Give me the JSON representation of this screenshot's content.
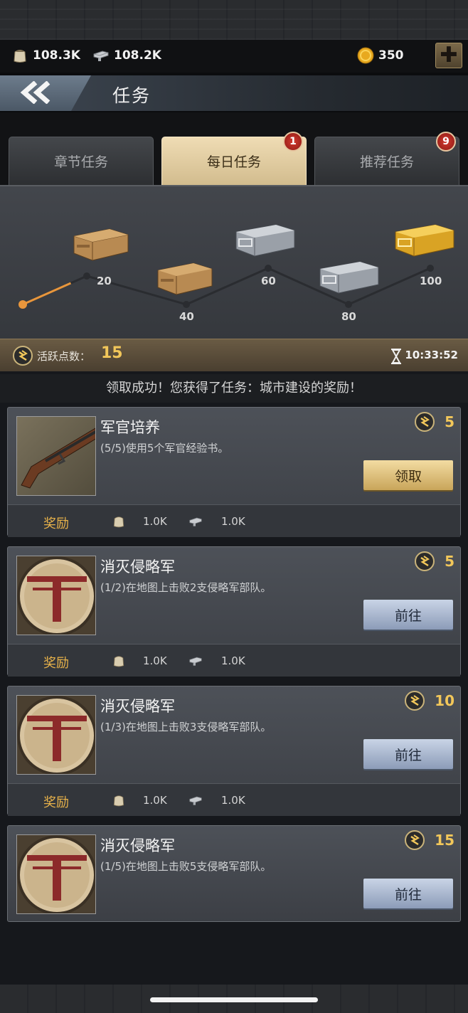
{
  "resources": {
    "food": {
      "icon": "supply-sack-icon",
      "value": "108.3K"
    },
    "steel": {
      "icon": "steel-ingot-icon",
      "value": "108.2K"
    },
    "gold": {
      "icon": "gold-coin-icon",
      "value": "350"
    },
    "add_icon": "plus-icon"
  },
  "header": {
    "title": "任务",
    "back_icon": "double-chevron-left-icon"
  },
  "tabs": [
    {
      "label": "章节任务",
      "active": false,
      "badge": ""
    },
    {
      "label": "每日任务",
      "active": true,
      "badge": "1"
    },
    {
      "label": "推荐任务",
      "active": false,
      "badge": "9"
    }
  ],
  "milestones": [
    {
      "points": "20",
      "chest": "wooden-chest-icon"
    },
    {
      "points": "40",
      "chest": "wooden-chest-icon"
    },
    {
      "points": "60",
      "chest": "steel-chest-icon"
    },
    {
      "points": "80",
      "chest": "steel-chest-icon"
    },
    {
      "points": "100",
      "chest": "gold-chest-icon"
    }
  ],
  "activity": {
    "label": "活跃点数：",
    "value": "15",
    "timer": "10:33:52",
    "progress_fraction": 0.15
  },
  "toast": "领取成功！您获得了任务：城市建设的奖励！",
  "tasks": [
    {
      "title": "军官培养",
      "desc": "(5/5)使用5个军官经验书。",
      "points": "5",
      "action": "领取",
      "action_type": "claim",
      "thumb": "rifle-image",
      "reward_label": "奖励",
      "rewards": [
        {
          "icon": "supply-sack-icon",
          "value": "1.0K"
        },
        {
          "icon": "steel-ingot-icon",
          "value": "1.0K"
        }
      ]
    },
    {
      "title": "消灭侵略军",
      "desc": "(1/2)在地图上击败2支侵略军部队。",
      "points": "5",
      "action": "前往",
      "action_type": "go",
      "thumb": "invader-emblem-image",
      "reward_label": "奖励",
      "rewards": [
        {
          "icon": "supply-sack-icon",
          "value": "1.0K"
        },
        {
          "icon": "steel-ingot-icon",
          "value": "1.0K"
        }
      ]
    },
    {
      "title": "消灭侵略军",
      "desc": "(1/3)在地图上击败3支侵略军部队。",
      "points": "10",
      "action": "前往",
      "action_type": "go",
      "thumb": "invader-emblem-image",
      "reward_label": "奖励",
      "rewards": [
        {
          "icon": "supply-sack-icon",
          "value": "1.0K"
        },
        {
          "icon": "steel-ingot-icon",
          "value": "1.0K"
        }
      ]
    },
    {
      "title": "消灭侵略军",
      "desc": "(1/5)在地图上击败5支侵略军部队。",
      "points": "15",
      "action": "前往",
      "action_type": "go",
      "thumb": "invader-emblem-image"
    }
  ],
  "colors": {
    "accent_gold": "#f2c75a",
    "progress_orange": "#e8963c",
    "reward_label": "#e8b24a"
  }
}
